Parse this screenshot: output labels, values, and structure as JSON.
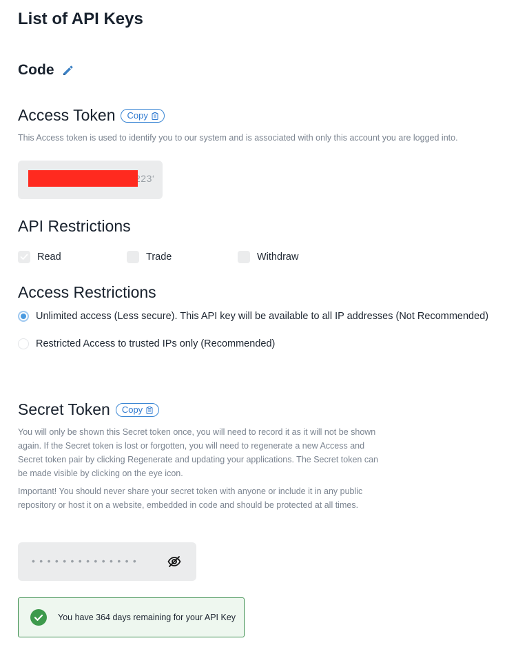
{
  "page_title": "List of API Keys",
  "code": {
    "title": "Code",
    "edit_icon": "pencil-icon"
  },
  "access_token": {
    "title": "Access Token",
    "copy_label": "Copy",
    "copy_icon": "clipboard-icon",
    "description": "This Access token is used to identify you to our system and is associated with only this account you are logged into.",
    "value_visible_suffix": "223‘"
  },
  "api_restrictions": {
    "title": "API Restrictions",
    "options": [
      {
        "label": "Read",
        "checked": true
      },
      {
        "label": "Trade",
        "checked": false
      },
      {
        "label": "Withdraw",
        "checked": false
      }
    ]
  },
  "access_restrictions": {
    "title": "Access Restrictions",
    "options": [
      {
        "label": "Unlimited access (Less secure). This API key will be available to all IP addresses (Not Recommended)",
        "selected": true
      },
      {
        "label": "Restricted Access to trusted IPs only (Recommended)",
        "selected": false
      }
    ]
  },
  "secret_token": {
    "title": "Secret Token",
    "copy_label": "Copy",
    "copy_icon": "clipboard-icon",
    "description_1": "You will only be shown this Secret token once, you will need to record it as it will not be shown again. If the Secret token is lost or forgotten, you will need to regenerate a new Access and Secret token pair by clicking Regenerate and updating your applications. The Secret token can be made visible by clicking on the eye icon.",
    "description_2": "Important! You should never share your secret token with anyone or include it in any public repository or host it on a website, embedded in code and should be protected at all times.",
    "masked_value": "••••••••••••••",
    "visibility_icon": "eye-off-icon"
  },
  "notice": {
    "text": "You have 364 days remaining for your API Key",
    "icon": "check-circle-icon",
    "color": "#3d8f4f"
  },
  "colors": {
    "accent": "#2f7ad0",
    "redaction": "#ff2a1f"
  }
}
